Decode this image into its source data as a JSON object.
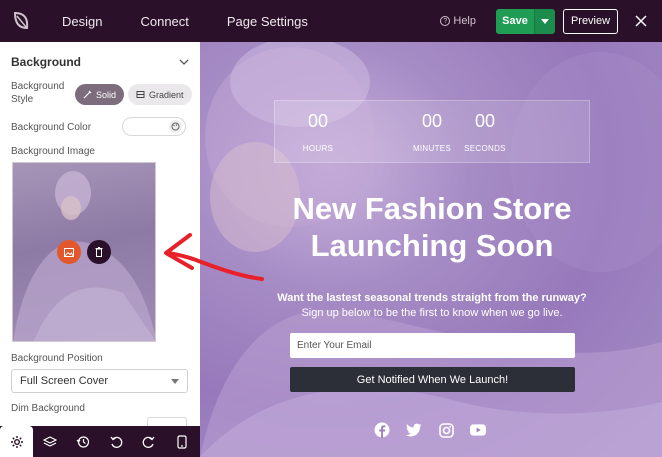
{
  "topbar": {
    "nav": [
      "Design",
      "Connect",
      "Page Settings"
    ],
    "help_label": "Help",
    "save_label": "Save",
    "preview_label": "Preview"
  },
  "sidebar": {
    "section_title": "Background",
    "background_style_label": "Background Style",
    "style_options": [
      "Solid",
      "Gradient"
    ],
    "background_color_label": "Background Color",
    "background_image_label": "Background Image",
    "background_position_label": "Background Position",
    "background_position_value": "Full Screen Cover",
    "dim_background_label": "Dim Background"
  },
  "bottom_toolbar": {
    "items": [
      "settings-icon",
      "layers-icon",
      "history-icon",
      "undo-icon",
      "redo-icon",
      "mobile-preview-icon"
    ]
  },
  "preview": {
    "countdown": [
      {
        "value": "00",
        "label": "HOURS"
      },
      {
        "value": "00",
        "label": "MINUTES"
      },
      {
        "value": "00",
        "label": "SECONDS"
      }
    ],
    "headline_line1": "New Fashion Store",
    "headline_line2": "Launching Soon",
    "subheadline": "Want the lastest seasonal trends straight from the runway?",
    "subtext": "Sign up below to be the first to know when we go live.",
    "email_placeholder": "Enter Your Email",
    "cta_label": "Get Notified When We Launch!",
    "socials": [
      "facebook-icon",
      "twitter-icon",
      "instagram-icon",
      "youtube-icon"
    ]
  },
  "colors": {
    "topbar_bg": "#2a1028",
    "save_green": "#1f9d55",
    "canvas_purple": "#9779bb",
    "arrow_red": "#e8202a",
    "replace_orange": "#e2582c"
  }
}
